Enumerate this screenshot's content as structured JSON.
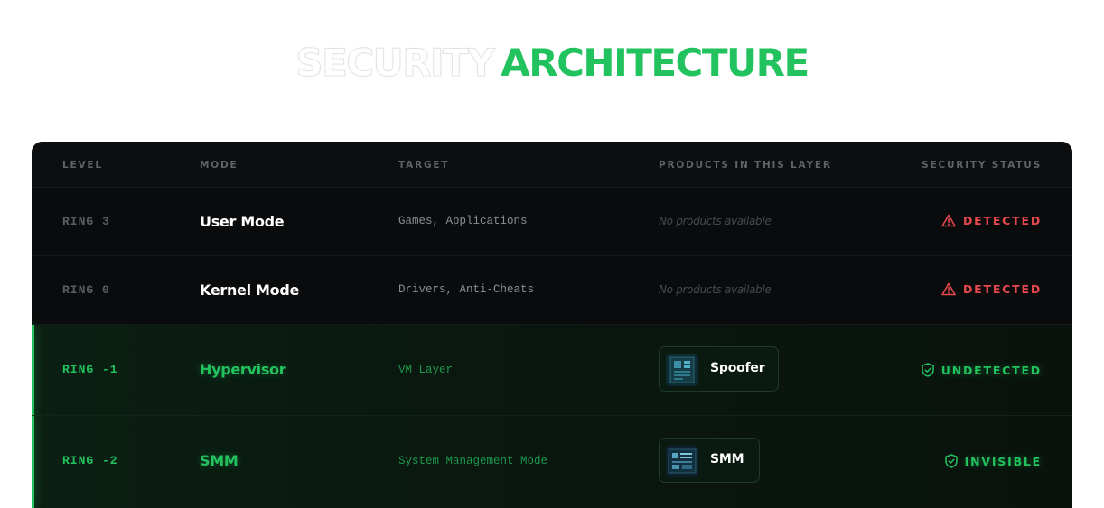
{
  "heading": {
    "part1": "SECURITY",
    "part2": "ARCHITECTURE"
  },
  "colors": {
    "accent_green": "#22c35e",
    "danger_red": "#e5484d",
    "table_bg": "#0a0b0c"
  },
  "table": {
    "headers": {
      "level": "LEVEL",
      "mode": "MODE",
      "target": "TARGET",
      "products": "PRODUCTS IN THIS LAYER",
      "status": "SECURITY STATUS"
    },
    "rows": [
      {
        "level": "RING 3",
        "mode": "User Mode",
        "target": "Games, Applications",
        "products_text": "No products available",
        "status": "DETECTED",
        "status_icon": "warning-triangle-icon"
      },
      {
        "level": "RING 0",
        "mode": "Kernel Mode",
        "target": "Drivers, Anti-Cheats",
        "products_text": "No products available",
        "status": "DETECTED",
        "status_icon": "warning-triangle-icon"
      },
      {
        "level": "RING -1",
        "mode": "Hypervisor",
        "target": "VM Layer",
        "product_name": "Spoofer",
        "product_icon": "motherboard-thumbnail",
        "status": "UNDETECTED",
        "status_icon": "shield-check-icon"
      },
      {
        "level": "RING -2",
        "mode": "SMM",
        "target": "System Management Mode",
        "product_name": "SMM",
        "product_icon": "circuit-thumbnail",
        "status": "INVISIBLE",
        "status_icon": "shield-check-icon"
      }
    ]
  }
}
